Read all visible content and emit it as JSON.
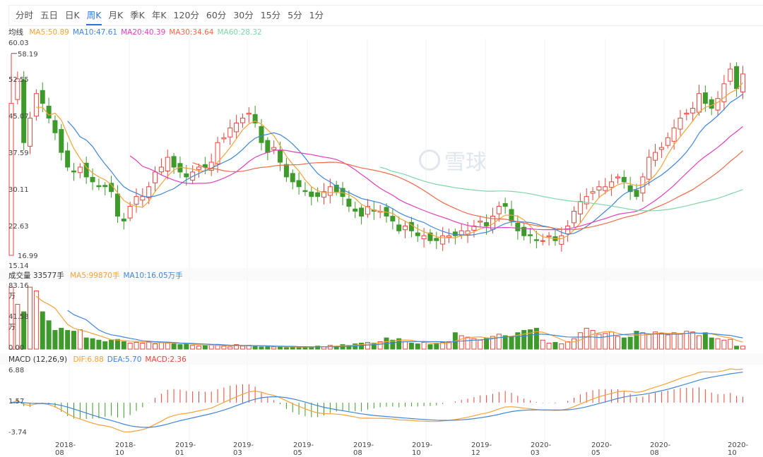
{
  "tabs": [
    "分时",
    "五日",
    "日K",
    "周K",
    "月K",
    "季K",
    "年K",
    "120分",
    "60分",
    "30分",
    "15分",
    "5分",
    "1分"
  ],
  "active_tab": "周K",
  "ma_legend": {
    "title": "均线",
    "ma5": "MA5:50.89",
    "ma10": "MA10:47.61",
    "ma20": "MA20:40.39",
    "ma30": "MA30:34.64",
    "ma60": "MA60:28.32"
  },
  "vol_legend": {
    "title": "成交量 33577手",
    "ma5": "MA5:99870手",
    "ma10": "MA10:16.05万手"
  },
  "macd_legend": {
    "title": "MACD (12,26,9)",
    "dif": "DIF:6.88",
    "dea": "DEA:5.70",
    "macd": "MACD:2.36"
  },
  "watermark": "雪球",
  "colors": {
    "up": "#e8453c",
    "down": "#3d9a2b",
    "ma5": "#f5a33a",
    "ma10": "#3f86d8",
    "ma20": "#e03fc0",
    "ma30": "#ef6a4a",
    "ma60": "#7fd6a6"
  },
  "chart_data": {
    "type": "candlestick",
    "price_axis": {
      "max": "60.03",
      "ticks": [
        "60.03",
        "52.55",
        "45.07",
        "37.59",
        "30.11",
        "22.63",
        "15.14"
      ],
      "range": [
        15.14,
        60.03
      ]
    },
    "high_label": "58.19",
    "low_label": "16.99",
    "volume_axis": {
      "ticks": [
        "83.16万",
        "41.58万",
        "0.00"
      ],
      "range": [
        0,
        83.16
      ]
    },
    "macd_axis": {
      "ticks": [
        "6.88",
        "1.57",
        "-3.74"
      ],
      "range": [
        -3.74,
        6.88
      ]
    },
    "x_labels": [
      "2018-08",
      "2018-10",
      "2019-01",
      "2019-03",
      "2019-05",
      "2019-08",
      "2019-10",
      "2019-12",
      "2020-03",
      "2020-05",
      "2020-08",
      "2020-10"
    ],
    "first_candle": {
      "open": 17,
      "high": 58.19,
      "low": 16.99,
      "close": 48
    },
    "closes": [
      48,
      53,
      40,
      45,
      50,
      48,
      45,
      42,
      38,
      35,
      34,
      35,
      33,
      32,
      31,
      31,
      30,
      25,
      24,
      27,
      29,
      29,
      31,
      34,
      35,
      37,
      35,
      34,
      33,
      34,
      35,
      35,
      36,
      40,
      41,
      43,
      44,
      45,
      46,
      44,
      40,
      38,
      39,
      36,
      33,
      32,
      31,
      30,
      29,
      29,
      30,
      31,
      30,
      29,
      27,
      26,
      25,
      27,
      26,
      26,
      25,
      24,
      22,
      23,
      22,
      21,
      21,
      20,
      20,
      21,
      21,
      21,
      22,
      22,
      23,
      24,
      23,
      25,
      27,
      27,
      24,
      22,
      21,
      21,
      20,
      20,
      21,
      20,
      21,
      23,
      26,
      28,
      29,
      30,
      31,
      31,
      32,
      33,
      32,
      30,
      29,
      33,
      37,
      38,
      39,
      41,
      43,
      45,
      46,
      47,
      50,
      48,
      47,
      49,
      52,
      55,
      51,
      54
    ],
    "volumes_wan": [
      83,
      60,
      50,
      83,
      78,
      50,
      38,
      25,
      28,
      25,
      24,
      26,
      15,
      14,
      12,
      10,
      12,
      13,
      10,
      8,
      9,
      8,
      10,
      7,
      9,
      8,
      7,
      6,
      7,
      5,
      4,
      5,
      6,
      5,
      4,
      3,
      6,
      4,
      5,
      4,
      3,
      4,
      3,
      3,
      2,
      3,
      2,
      3,
      3,
      4,
      3,
      5,
      4,
      6,
      5,
      7,
      8,
      9,
      8,
      10,
      15,
      12,
      14,
      10,
      8,
      7,
      9,
      6,
      8,
      9,
      10,
      22,
      18,
      16,
      14,
      12,
      15,
      17,
      20,
      18,
      16,
      22,
      25,
      26,
      28,
      12,
      8,
      9,
      7,
      10,
      14,
      22,
      28,
      25,
      20,
      21,
      23,
      17,
      15,
      16,
      24,
      22,
      20,
      23,
      21,
      19,
      22,
      20,
      24,
      23,
      18,
      22,
      15,
      14,
      12,
      13,
      4,
      4
    ]
  }
}
